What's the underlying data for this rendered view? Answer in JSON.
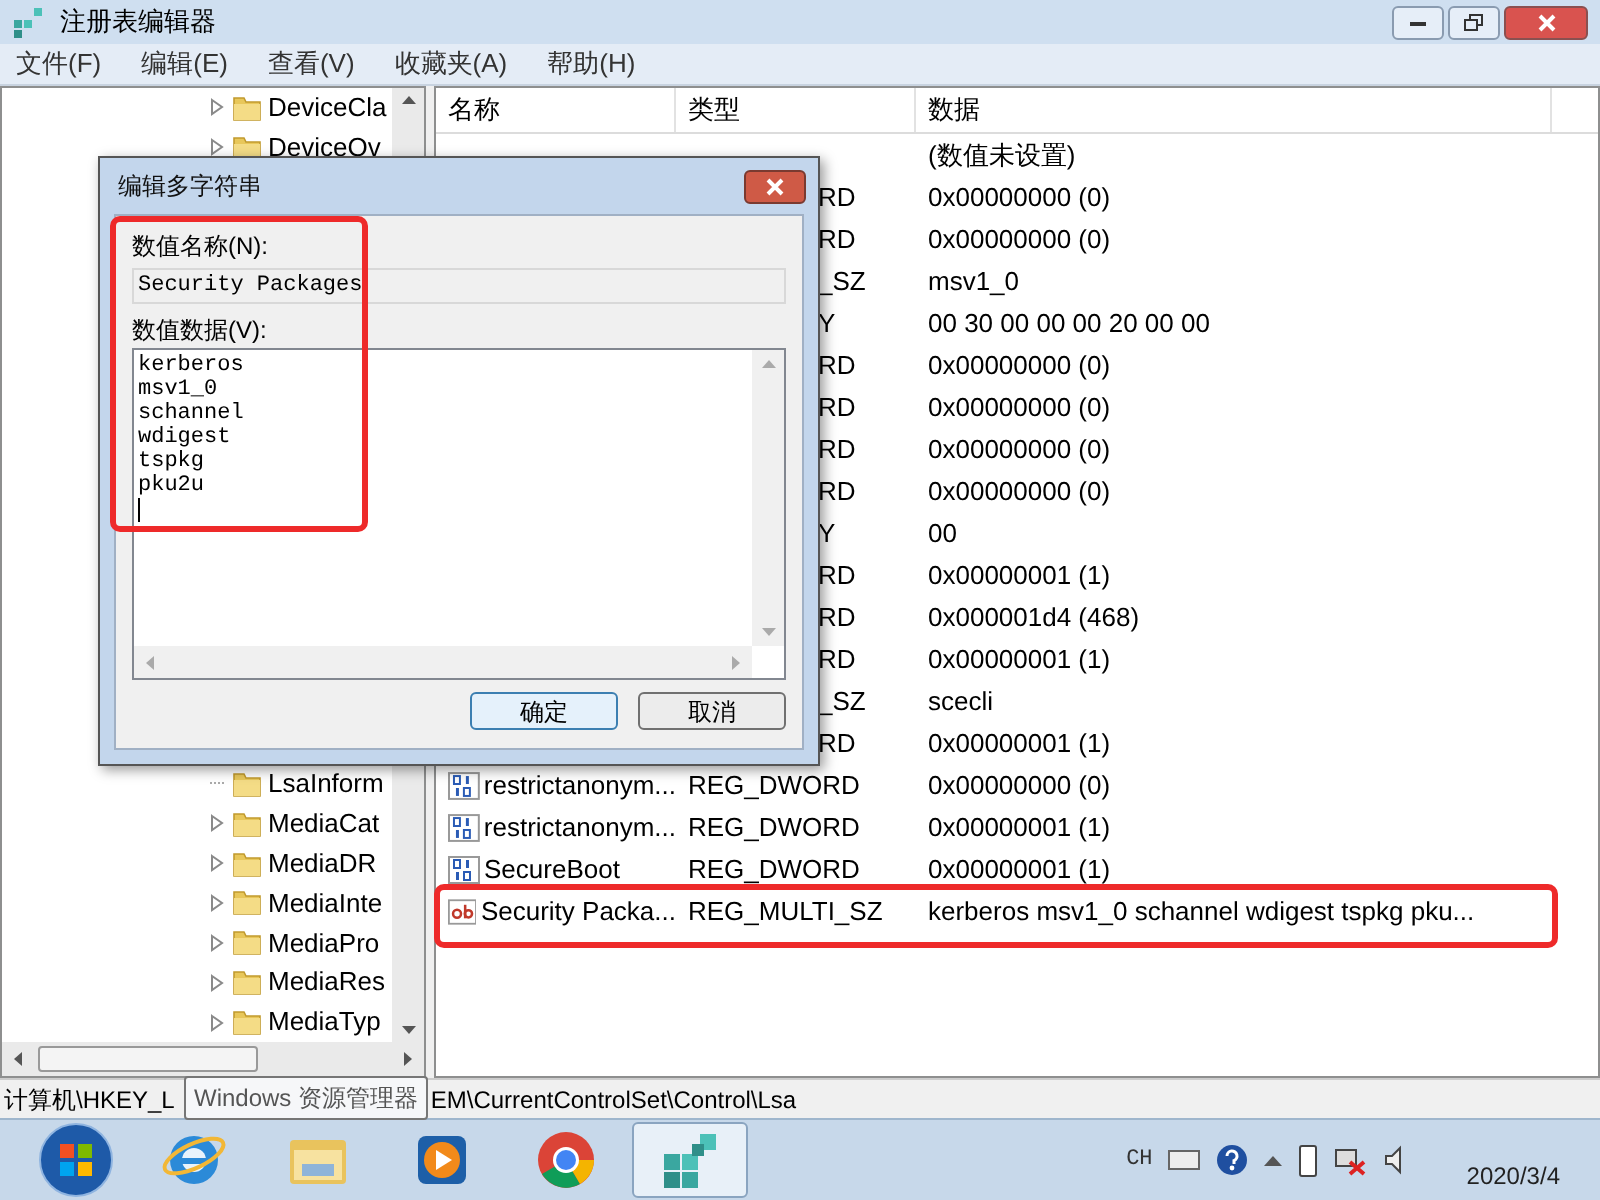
{
  "window": {
    "title": "注册表编辑器"
  },
  "menu": [
    "文件(F)",
    "编辑(E)",
    "查看(V)",
    "收藏夹(A)",
    "帮助(H)"
  ],
  "tree": {
    "upper": [
      {
        "label": "DeviceCla",
        "expandable": true
      },
      {
        "label": "DeviceOv",
        "expandable": true
      }
    ],
    "lower": [
      {
        "label": "LsaInform",
        "expandable": false
      },
      {
        "label": "MediaCat",
        "expandable": true
      },
      {
        "label": "MediaDR",
        "expandable": true
      },
      {
        "label": "MediaInte",
        "expandable": true
      },
      {
        "label": "MediaPro",
        "expandable": true
      },
      {
        "label": "MediaRes",
        "expandable": true
      },
      {
        "label": "MediaTyp",
        "expandable": true
      }
    ]
  },
  "table": {
    "columns": [
      "名称",
      "类型",
      "数据"
    ],
    "rows": [
      {
        "data": "(数值未设置)"
      },
      {
        "type": "RD",
        "data": "0x00000000 (0)"
      },
      {
        "type": "RD",
        "data": "0x00000000 (0)"
      },
      {
        "type": "_SZ",
        "data": "msv1_0"
      },
      {
        "type": "Y",
        "data": "00 30 00 00 00 20 00 00"
      },
      {
        "type": "RD",
        "data": "0x00000000 (0)"
      },
      {
        "type": "RD",
        "data": "0x00000000 (0)"
      },
      {
        "type": "RD",
        "data": "0x00000000 (0)"
      },
      {
        "type": "RD",
        "data": "0x00000000 (0)"
      },
      {
        "type": "Y",
        "data": "00"
      },
      {
        "type": "RD",
        "data": "0x00000001 (1)"
      },
      {
        "type": "RD",
        "data": "0x000001d4 (468)"
      },
      {
        "type": "RD",
        "data": "0x00000001 (1)"
      },
      {
        "type": "_SZ",
        "data": "scecli"
      },
      {
        "type": "RD",
        "data": "0x00000001 (1)"
      },
      {
        "name": "restrictanonym...",
        "kind": "binary",
        "type": "REG_DWORD",
        "data": "0x00000000 (0)"
      },
      {
        "name": "restrictanonym...",
        "kind": "binary",
        "type": "REG_DWORD",
        "data": "0x00000001 (1)"
      },
      {
        "name": "SecureBoot",
        "kind": "binary",
        "type": "REG_DWORD",
        "data": "0x00000001 (1)"
      },
      {
        "name": "Security Packa...",
        "kind": "string",
        "type": "REG_MULTI_SZ",
        "data": "kerberos msv1_0 schannel wdigest tspkg pku..."
      }
    ]
  },
  "status_bar": {
    "path_start": "计算机\\HKEY_L",
    "path_end": "EM\\CurrentControlSet\\Control\\Lsa",
    "tooltip": "Windows 资源管理器"
  },
  "dialog": {
    "title": "编辑多字符串",
    "name_label": "数值名称(N):",
    "name_value": "Security Packages",
    "data_label": "数值数据(V):",
    "data_lines": [
      "kerberos",
      "msv1_0",
      "schannel",
      "wdigest",
      "tspkg",
      "pku2u"
    ],
    "buttons": [
      {
        "label": "确定",
        "focused": true
      },
      {
        "label": "取消",
        "focused": false
      }
    ]
  },
  "taskbar": {
    "apps": [
      {
        "kind": "ie",
        "active": false
      },
      {
        "kind": "explorer",
        "active": false
      },
      {
        "kind": "media",
        "active": false
      },
      {
        "kind": "chrome",
        "active": false
      },
      {
        "kind": "regedit",
        "active": true
      }
    ],
    "language": "CH",
    "date": "2020/3/4"
  }
}
